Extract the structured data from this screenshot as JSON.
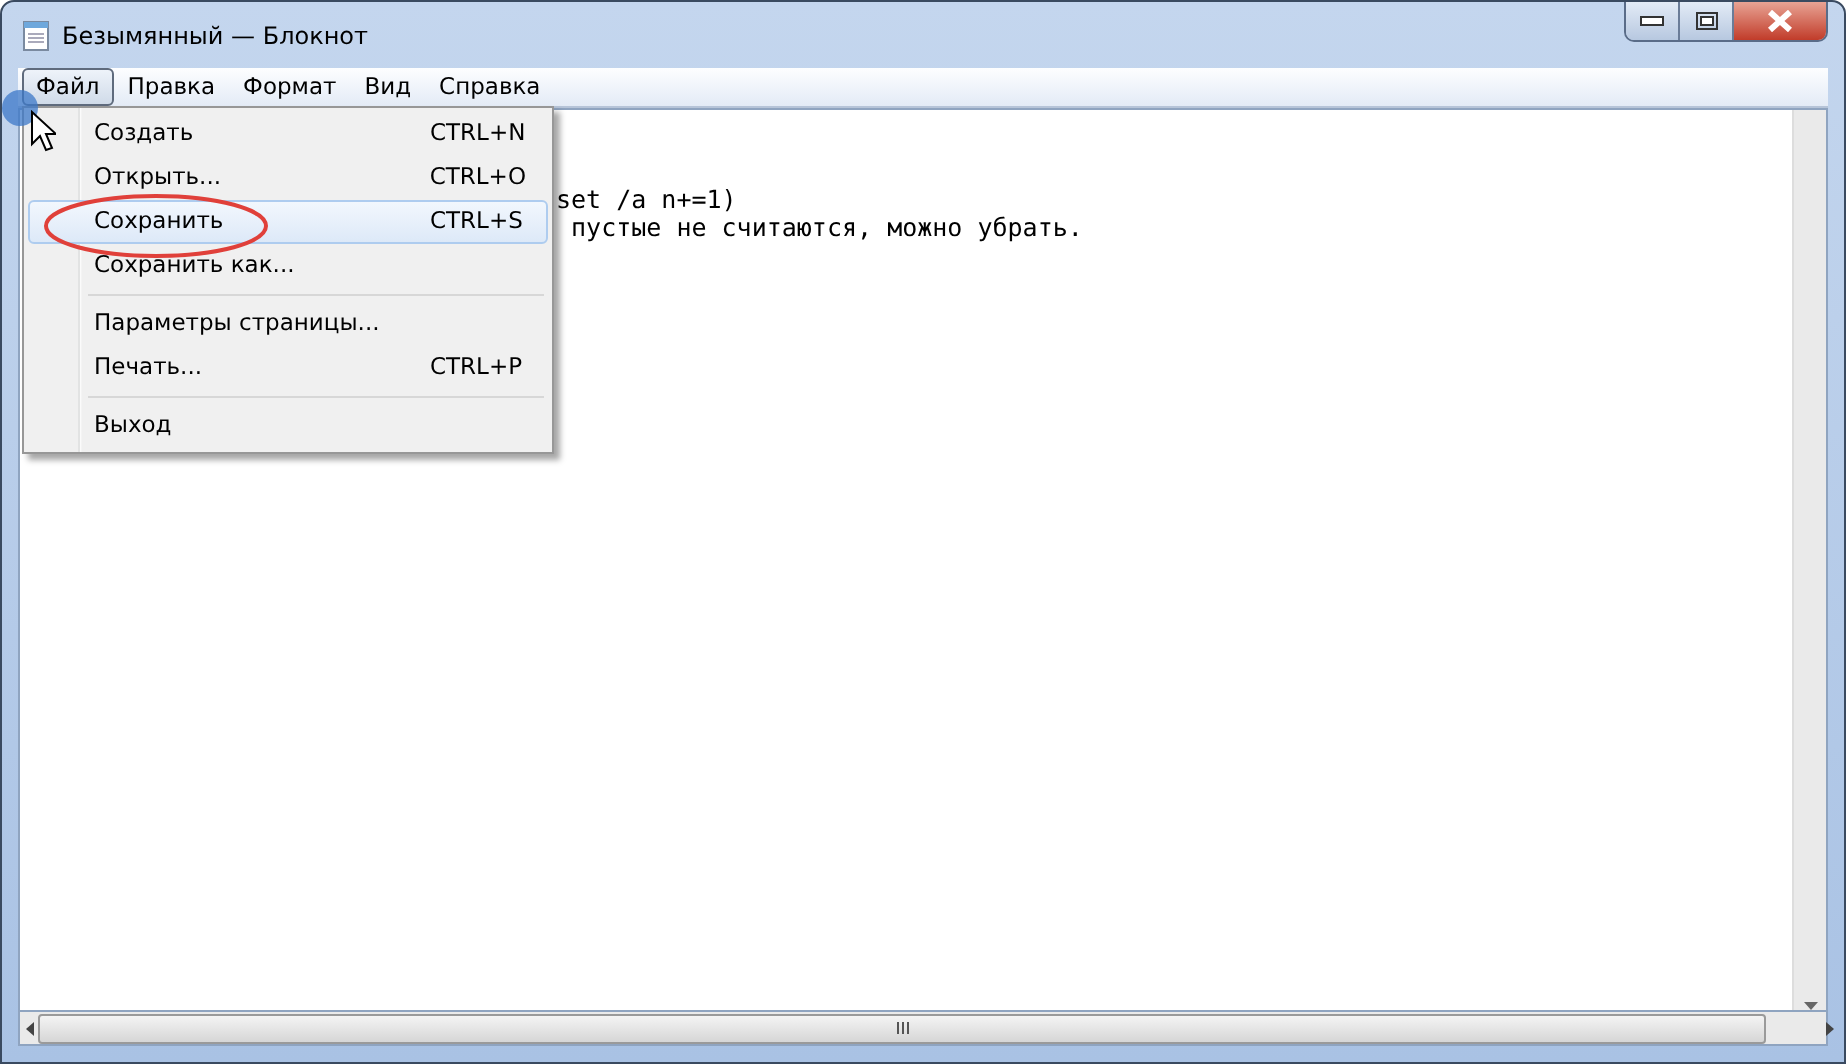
{
  "window": {
    "title": "Безымянный — Блокнот"
  },
  "menu_bar": [
    {
      "label": "Файл",
      "selected": true
    },
    {
      "label": "Правка",
      "selected": false
    },
    {
      "label": "Формат",
      "selected": false
    },
    {
      "label": "Вид",
      "selected": false
    },
    {
      "label": "Справка",
      "selected": false
    }
  ],
  "file_menu": [
    {
      "kind": "item",
      "label": "Создать",
      "shortcut": "CTRL+N",
      "selected": false
    },
    {
      "kind": "item",
      "label": "Открыть...",
      "shortcut": "CTRL+O",
      "selected": false
    },
    {
      "kind": "item",
      "label": "Сохранить",
      "shortcut": "CTRL+S",
      "selected": true
    },
    {
      "kind": "item",
      "label": "Сохранить как...",
      "selected": false
    },
    {
      "kind": "separator"
    },
    {
      "kind": "item",
      "label": "Параметры страницы...",
      "selected": false
    },
    {
      "kind": "item",
      "label": "Печать...",
      "shortcut": "CTRL+P",
      "selected": false
    },
    {
      "kind": "separator"
    },
    {
      "kind": "item",
      "label": "Выход",
      "selected": false
    }
  ],
  "editor": {
    "lines": [
      "set /a n+=1)",
      " пустые не считаются, можно убрать."
    ]
  }
}
